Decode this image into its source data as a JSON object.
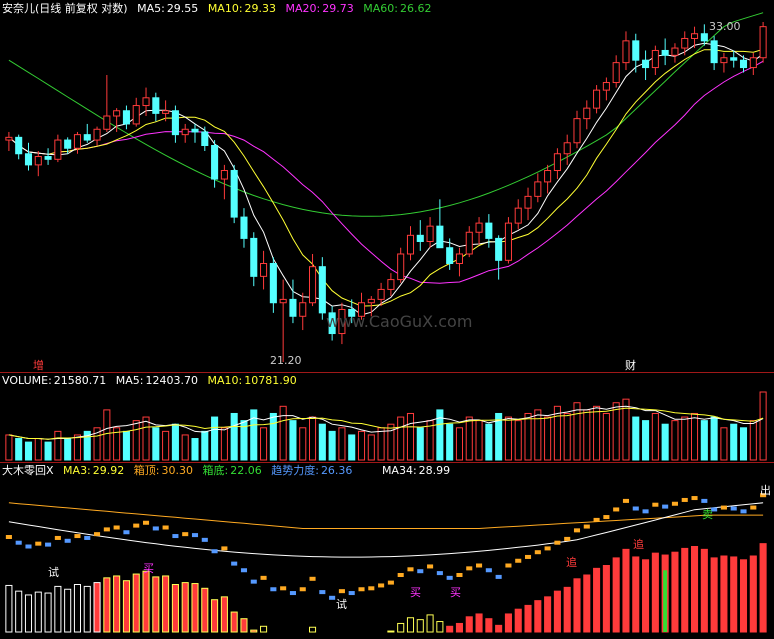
{
  "colors": {
    "up": "#ff3b3b",
    "down": "#54ffff",
    "ma5": "#ffffff",
    "ma10": "#ffff33",
    "ma20": "#ff33ff",
    "ma60": "#33cc33",
    "sep": "#a01818",
    "ind_line": "#ffaa22",
    "ind_yellow": "#ffff55",
    "ind_green": "#33dd33",
    "ind_blue": "#5599ff",
    "ind_white": "#ffffff"
  },
  "main": {
    "name": "安奈儿(日线 前复权 对数)",
    "ma5_label": "MA5:",
    "ma5": "29.55",
    "ma10_label": "MA10:",
    "ma10": "29.33",
    "ma20_label": "MA20:",
    "ma20": "29.73",
    "ma60_label": "MA60:",
    "ma60": "26.62",
    "high_label": "33.00",
    "low_label": "21.20",
    "badge_left": "增",
    "badge_right": "财",
    "watermark": "www.CaoGuX.com"
  },
  "volume": {
    "label": "VOLUME:",
    "value": "21580.71",
    "ma5_label": "MA5:",
    "ma5": "12403.70",
    "ma10_label": "MA10:",
    "ma10": "10781.90"
  },
  "indicator": {
    "name": "大木零回X",
    "ma3_label": "MA3:",
    "ma3": "29.92",
    "top_label": "箱顶:",
    "top": "30.30",
    "bottom_label": "箱底:",
    "bottom": "22.06",
    "trend_label": "趋势力度:",
    "trend": "26.36",
    "ma34_label": "MA34:",
    "ma34": "28.99",
    "marker_buy": "买",
    "marker_sell": "卖",
    "marker_try": "试",
    "marker_chase": "追",
    "marker_out": "出"
  },
  "chart_data": {
    "type": "candlestick",
    "price_high": 33.0,
    "price_low": 21.2,
    "candles": [
      [
        28.3,
        28.6,
        27.9,
        28.4
      ],
      [
        28.4,
        28.5,
        27.6,
        27.8
      ],
      [
        27.8,
        28.2,
        27.2,
        27.4
      ],
      [
        27.4,
        27.9,
        27.0,
        27.7
      ],
      [
        27.7,
        28.0,
        27.4,
        27.6
      ],
      [
        27.6,
        28.5,
        27.5,
        28.3
      ],
      [
        28.3,
        28.4,
        27.8,
        28.0
      ],
      [
        28.0,
        28.6,
        27.8,
        28.5
      ],
      [
        28.5,
        28.9,
        28.2,
        28.3
      ],
      [
        28.3,
        28.8,
        28.1,
        28.7
      ],
      [
        28.7,
        30.8,
        28.6,
        29.2
      ],
      [
        29.2,
        29.5,
        28.6,
        29.4
      ],
      [
        29.4,
        29.6,
        28.7,
        28.9
      ],
      [
        28.9,
        29.9,
        28.8,
        29.6
      ],
      [
        29.6,
        30.3,
        29.2,
        29.9
      ],
      [
        29.9,
        30.1,
        29.0,
        29.3
      ],
      [
        29.3,
        29.8,
        29.0,
        29.4
      ],
      [
        29.4,
        29.6,
        28.2,
        28.5
      ],
      [
        28.5,
        28.9,
        28.2,
        28.7
      ],
      [
        28.7,
        28.9,
        28.2,
        28.6
      ],
      [
        28.6,
        28.8,
        27.9,
        28.1
      ],
      [
        28.1,
        28.3,
        26.6,
        26.9
      ],
      [
        26.9,
        27.4,
        26.2,
        27.2
      ],
      [
        27.2,
        27.4,
        25.4,
        25.6
      ],
      [
        25.6,
        25.9,
        24.6,
        24.9
      ],
      [
        24.9,
        25.1,
        23.4,
        23.7
      ],
      [
        23.7,
        24.5,
        23.3,
        24.1
      ],
      [
        24.1,
        24.3,
        22.6,
        22.9
      ],
      [
        22.9,
        23.6,
        21.2,
        23.0
      ],
      [
        23.0,
        23.6,
        22.3,
        22.5
      ],
      [
        22.5,
        23.2,
        22.1,
        22.9
      ],
      [
        22.9,
        24.4,
        22.8,
        24.0
      ],
      [
        24.0,
        24.3,
        22.4,
        22.6
      ],
      [
        22.6,
        22.8,
        21.8,
        22.0
      ],
      [
        22.0,
        22.9,
        21.7,
        22.7
      ],
      [
        22.7,
        23.0,
        22.3,
        22.5
      ],
      [
        22.5,
        23.2,
        22.4,
        22.9
      ],
      [
        22.9,
        23.1,
        22.5,
        23.0
      ],
      [
        23.0,
        23.5,
        22.8,
        23.3
      ],
      [
        23.3,
        23.8,
        23.1,
        23.6
      ],
      [
        23.6,
        24.6,
        23.5,
        24.4
      ],
      [
        24.4,
        25.3,
        24.2,
        25.0
      ],
      [
        25.0,
        25.5,
        24.5,
        24.8
      ],
      [
        24.8,
        25.6,
        24.6,
        25.3
      ],
      [
        25.3,
        26.2,
        24.9,
        24.6
      ],
      [
        24.6,
        24.9,
        23.9,
        24.1
      ],
      [
        24.1,
        24.6,
        23.7,
        24.4
      ],
      [
        24.4,
        25.3,
        24.3,
        25.1
      ],
      [
        25.1,
        25.6,
        24.7,
        25.4
      ],
      [
        25.4,
        25.7,
        24.6,
        24.9
      ],
      [
        24.9,
        25.0,
        23.6,
        24.2
      ],
      [
        24.2,
        25.6,
        24.1,
        25.4
      ],
      [
        25.4,
        26.2,
        25.2,
        25.9
      ],
      [
        25.9,
        26.6,
        25.5,
        26.3
      ],
      [
        26.3,
        27.1,
        26.1,
        26.8
      ],
      [
        26.8,
        27.4,
        26.4,
        27.2
      ],
      [
        27.2,
        28.0,
        26.9,
        27.8
      ],
      [
        27.8,
        28.5,
        27.4,
        28.2
      ],
      [
        28.2,
        29.4,
        28.0,
        29.1
      ],
      [
        29.1,
        29.8,
        28.7,
        29.5
      ],
      [
        29.5,
        30.4,
        29.3,
        30.2
      ],
      [
        30.2,
        30.7,
        29.8,
        30.5
      ],
      [
        30.5,
        31.6,
        30.3,
        31.3
      ],
      [
        31.3,
        32.6,
        31.0,
        32.2
      ],
      [
        32.2,
        32.5,
        30.9,
        31.4
      ],
      [
        31.4,
        31.8,
        30.6,
        31.1
      ],
      [
        31.1,
        32.0,
        30.8,
        31.8
      ],
      [
        31.8,
        32.3,
        31.2,
        31.6
      ],
      [
        31.6,
        32.1,
        31.3,
        31.9
      ],
      [
        31.9,
        32.6,
        31.6,
        32.3
      ],
      [
        32.3,
        32.8,
        31.9,
        32.5
      ],
      [
        32.5,
        32.9,
        32.0,
        32.2
      ],
      [
        32.2,
        32.4,
        31.0,
        31.3
      ],
      [
        31.3,
        31.7,
        30.9,
        31.5
      ],
      [
        31.5,
        31.8,
        31.1,
        31.4
      ],
      [
        31.4,
        31.6,
        30.9,
        31.1
      ],
      [
        31.1,
        31.7,
        30.8,
        31.5
      ],
      [
        31.5,
        33.0,
        31.3,
        32.8
      ]
    ],
    "volume_note": "volume bars shown relative only",
    "volume": [
      7,
      6,
      5,
      6,
      5,
      8,
      6,
      7,
      8,
      9,
      14,
      9,
      8,
      11,
      12,
      9,
      8,
      10,
      7,
      6,
      8,
      12,
      9,
      13,
      11,
      14,
      9,
      13,
      15,
      11,
      9,
      12,
      10,
      8,
      9,
      7,
      8,
      7,
      9,
      10,
      12,
      13,
      9,
      11,
      14,
      10,
      9,
      12,
      11,
      10,
      13,
      12,
      11,
      13,
      14,
      12,
      15,
      13,
      16,
      14,
      15,
      13,
      16,
      17,
      12,
      11,
      13,
      10,
      11,
      12,
      13,
      11,
      12,
      9,
      10,
      9,
      11,
      19
    ]
  }
}
